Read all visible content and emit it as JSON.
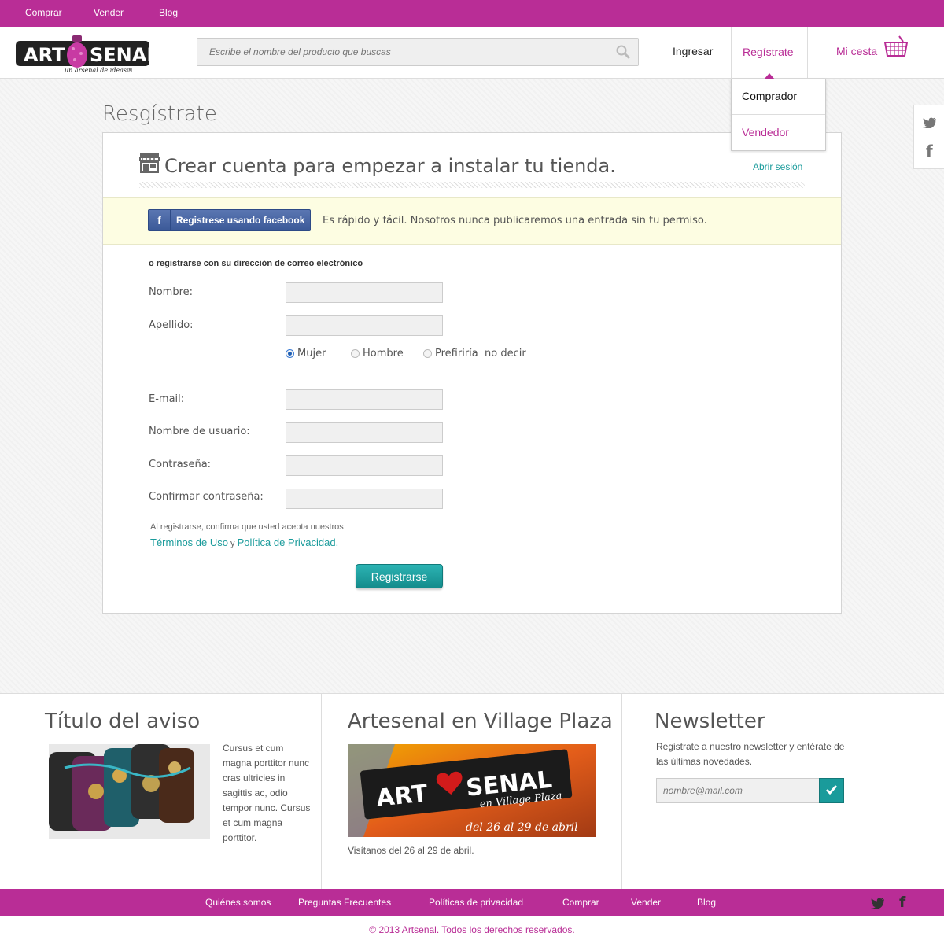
{
  "topnav": {
    "buy": "Comprar",
    "sell": "Vender",
    "blog": "Blog"
  },
  "brand": {
    "logo_text_left": "ART",
    "logo_text_right": "SENAL",
    "tagline": "un arsenal de ideas®",
    "accent": "#b92d96",
    "teal": "#1a9b9b"
  },
  "search": {
    "placeholder": "Escribe el nombre del producto que buscas"
  },
  "header_nav": {
    "login": "Ingresar",
    "register": "Regístrate",
    "cart": "Mi cesta"
  },
  "dropdown": {
    "buyer": "Comprador",
    "seller": "Vendedor"
  },
  "page": {
    "title": "Resgístrate"
  },
  "card": {
    "heading": "Crear cuenta para empezar a instalar tu tienda.",
    "login_link": "Abrir sesión",
    "facebook_button": "Registrese usando facebook",
    "facebook_note": "Es rápido y fácil. Nosotros nunca publicaremos una entrada sin tu permiso.",
    "email_intro": "o registrarse con su dirección de correo electrónico"
  },
  "form": {
    "first_name": "Nombre:",
    "last_name": "Apellido:",
    "gender": {
      "female": "Mujer",
      "male": "Hombre",
      "none": "Prefiriría  no decir",
      "selected": "Mujer"
    },
    "email": "E-mail:",
    "username": "Nombre de usuario:",
    "password": "Contraseña:",
    "confirm_password": "Confirmar contraseña:",
    "terms_text": "Al registrarse, confirma que usted acepta nuestros",
    "terms_link": "Términos de Uso",
    "terms_and": "y",
    "privacy_link": "Política de Privacidad",
    "terms_end": ".",
    "submit": "Registrarse"
  },
  "footer": {
    "notice": {
      "title": "Título del aviso",
      "text": "Cursus et cum magna porttitor nunc cras ultricies in sagittis ac, odio tempor nunc. Cursus et cum magna porttitor."
    },
    "event": {
      "title": "Artesenal en Village Plaza",
      "banner_art": "ART",
      "banner_senal": "SENAL",
      "banner_sub": "en Village Plaza",
      "banner_dates": "del 26 al 29 de abril",
      "caption": "Visítanos del 26 al 29 de abril."
    },
    "newsletter": {
      "title": "Newsletter",
      "text": "Registrate a nuestro newsletter y entérate de las últimas novedades.",
      "placeholder": "nombre@mail.com"
    }
  },
  "bottom_nav": {
    "about": "Quiénes somos",
    "faq": "Preguntas Frecuentes",
    "privacy": "Políticas de privacidad",
    "buy": "Comprar",
    "sell": "Vender",
    "blog": "Blog"
  },
  "copyright": "© 2013 Artsenal. Todos los derechos reservados."
}
